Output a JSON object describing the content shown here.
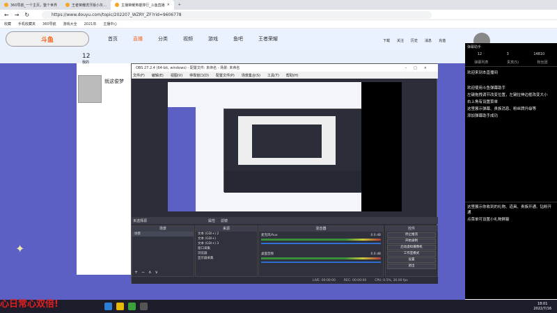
{
  "browser": {
    "tabs": [
      {
        "label": "360导航_一个主页，整个世界"
      },
      {
        "label": "王者荣耀虎牙版小灰…"
      },
      {
        "label": "主播荣耀英雄排行_斗鱼直播"
      }
    ],
    "url": "https://www.douyu.com/topic/202207_WZRY_ZF?rid=9606778",
    "bookmarks": [
      "收藏",
      "手机收藏夹",
      "360导航",
      "游戏大全",
      "2021年",
      "主播中心"
    ]
  },
  "site": {
    "logo_text": "斗鱼",
    "nav": [
      "首页",
      "直播",
      "分类",
      "视频",
      "游戏",
      "鱼吧",
      "王者荣耀"
    ],
    "header_actions": [
      "下载",
      "关注",
      "历史",
      "消息",
      "充值"
    ],
    "room_count": "12",
    "room_label": "我的",
    "streamer_name": "就这俊梦"
  },
  "obs": {
    "title": "OBS 27.2.4 (64-bit, windows) - 配置文件: 未命名 - 场景: 未命名",
    "menu": [
      "文件(F)",
      "编辑(E)",
      "视图(V)",
      "停靠窗口(D)",
      "配置文件(P)",
      "场景集合(S)",
      "工具(T)",
      "帮助(H)"
    ],
    "scene_bar": {
      "label": "未选择源",
      "properties": "属性",
      "filters": "滤镜"
    },
    "docks": {
      "scenes": {
        "title": "场景",
        "items": [
          "场景"
        ]
      },
      "sources": {
        "title": "来源",
        "items": [
          "文本 (GDI+) 2",
          "文本 (GDI+)",
          "文本 (GDI+) 3",
          "窗口采集",
          "浏览器",
          "显示器采集"
        ]
      },
      "mixer": {
        "title": "混音器",
        "tracks": [
          {
            "name": "麦克风/Aux",
            "level": "0.0 dB"
          },
          {
            "name": "桌面音频",
            "level": "0.0 dB"
          }
        ]
      },
      "controls": {
        "title": "控件",
        "buttons": [
          "停止推流",
          "开始录制",
          "启动虚拟摄像机",
          "工作室模式",
          "设置",
          "退出"
        ]
      }
    },
    "status": {
      "live": "LIVE: 00:00:00",
      "rec": "REC: 00:00:00",
      "cpu": "CPU: 0.5%, 30.00 fps"
    }
  },
  "chat": {
    "header": "弹幕助手",
    "stats": [
      "12",
      "3",
      "14810"
    ],
    "tabs": [
      "弹幕列表",
      "贵宾(5)",
      "粉丝团"
    ],
    "welcome": "欢迎来到本直播间",
    "messages": [
      "欢迎使用斗鱼弹幕助手",
      "左键拖拽调节改变位置，左键拉伸边框改变大小",
      "右上角有设置菜单",
      "这里展示弹幕、贵族消息、粉丝牌升级等",
      "添加弹幕助手成功",
      "这里展示你收到的礼物、道具、贵族开通、钻粉开通",
      "点菜单可设置小礼物屏蔽"
    ]
  },
  "ticker": "心日常心双倍!",
  "taskbar": {
    "time": "18:01",
    "date": "2022/7/16"
  },
  "colors": {
    "side_purple": "#5c5fc4",
    "obs_dark": "#2b2e38",
    "ticker_red": "#e02020",
    "douyu_orange": "#f26522"
  }
}
